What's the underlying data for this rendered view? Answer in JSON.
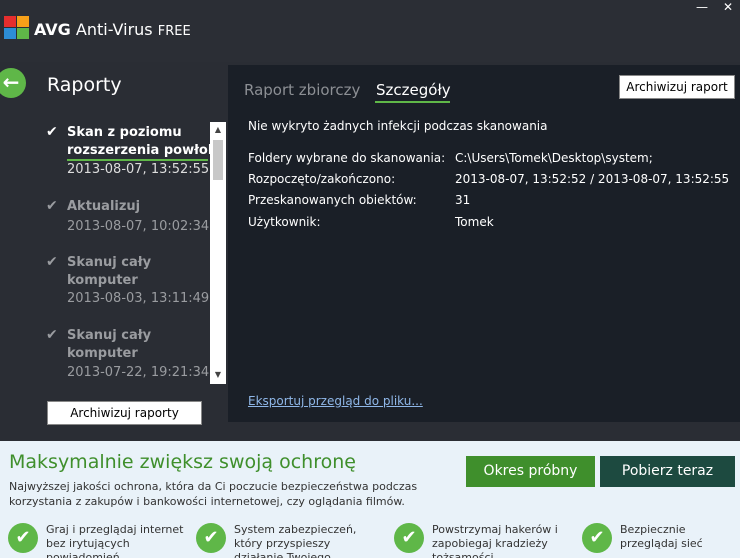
{
  "app": {
    "brand_bold": "AVG",
    "brand_rest": "Anti-Virus",
    "brand_edition": "FREE",
    "minimize": "—",
    "close": "✕",
    "logo_colors": [
      "#e62e2e",
      "#f6a019",
      "#2d8dd6",
      "#5fb748"
    ]
  },
  "left": {
    "title": "Raporty",
    "back_icon": "←",
    "items": [
      {
        "name_line1": "Skan z poziomu",
        "name_line2": "rozszerzenia powłoki",
        "date": "2013-08-07, 13:52:55",
        "state": "active"
      },
      {
        "name_line1": "Aktualizuj",
        "name_line2": "",
        "date": "2013-08-07, 10:02:34",
        "state": "done"
      },
      {
        "name_line1": "Skanuj cały",
        "name_line2": "komputer",
        "date": "2013-08-03, 13:11:49",
        "state": "done"
      },
      {
        "name_line1": "Skanuj cały",
        "name_line2": "komputer",
        "date": "2013-07-22, 19:21:34",
        "state": "done"
      }
    ],
    "archive_button": "Archiwizuj raporty"
  },
  "right": {
    "tab_summary": "Raport zbiorczy",
    "tab_details": "Szczegóły",
    "archive_button": "Archiwizuj raport",
    "message": "Nie wykryto żadnych infekcji podczas skanowania",
    "details": [
      {
        "label": "Foldery wybrane do skanowania:",
        "value": "C:\\Users\\Tomek\\Desktop\\system;"
      },
      {
        "label": "Rozpoczęto/zakończono:",
        "value": "2013-08-07, 13:52:52 / 2013-08-07, 13:52:55"
      },
      {
        "label": "Przeskanowanych obiektów:",
        "value": "31"
      },
      {
        "label": "Użytkownik:",
        "value": "Tomek"
      }
    ],
    "export_link": "Eksportuj przegląd do pliku..."
  },
  "ad": {
    "title": "Maksymalnie zwiększ swoją ochronę",
    "text": "Najwyższej jakości ochrona, która da Ci poczucie bezpieczeństwa podczas korzystania z zakupów i bankowości internetowej, czy oglądania filmów.",
    "trial_button": "Okres próbny",
    "buy_button": "Pobierz teraz",
    "features": [
      "Graj i przeglądaj internet bez irytujących powiadomień",
      "System zabezpieczeń, który przyspieszy działanie Twojego komputera",
      "Powstrzymaj hakerów i zapobiegaj kradzieży tożsamości",
      "Bezpiecznie przeglądaj sieć"
    ]
  }
}
